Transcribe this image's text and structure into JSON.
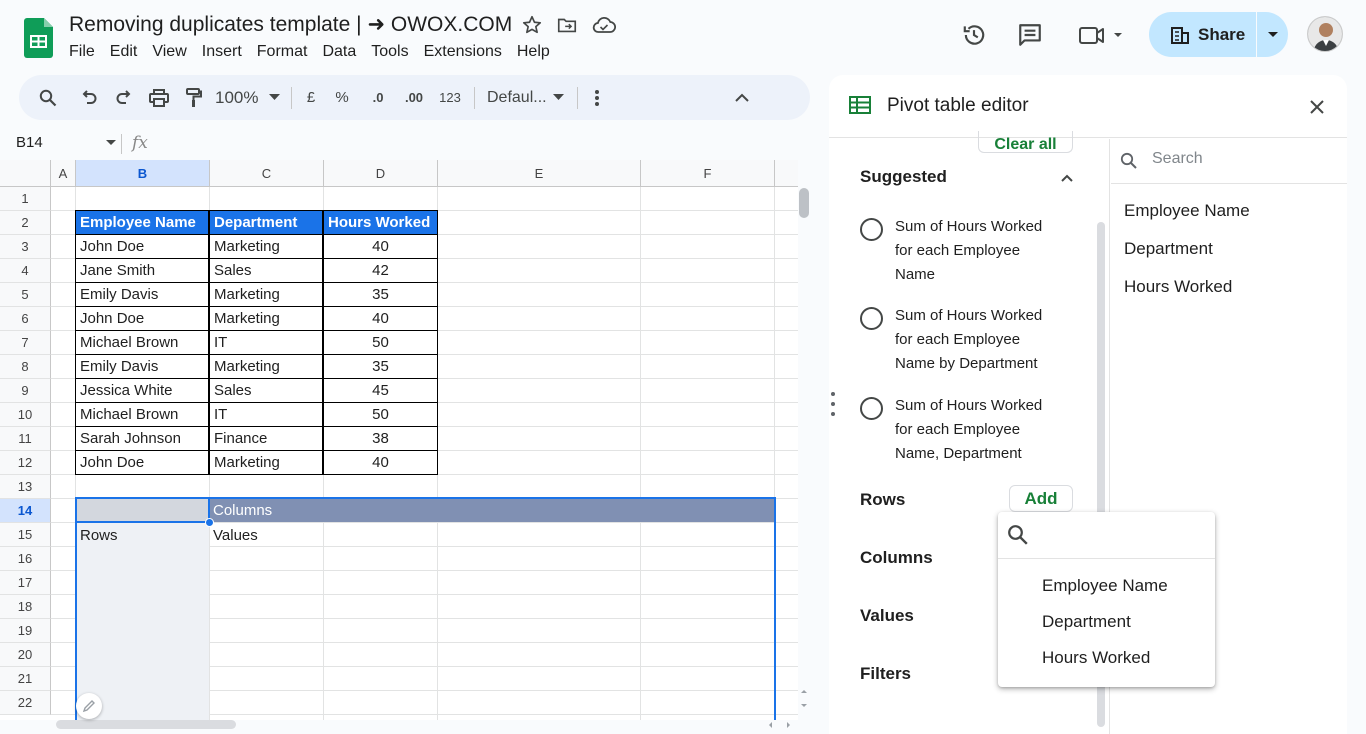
{
  "doc": {
    "title": "Removing duplicates template | ➜ OWOX.COM",
    "menu": [
      "File",
      "Edit",
      "View",
      "Insert",
      "Format",
      "Data",
      "Tools",
      "Extensions",
      "Help"
    ]
  },
  "header": {
    "share_label": "Share"
  },
  "toolbar": {
    "zoom": "100%",
    "currency": "£",
    "percent": "%",
    "dec_decrease": ".0",
    "dec_increase": ".00",
    "number_format": "123",
    "font": "Defaul..."
  },
  "formula_bar": {
    "name_box": "B14",
    "fx": "fx"
  },
  "sheet": {
    "columns": [
      "A",
      "B",
      "C",
      "D",
      "E",
      "F"
    ],
    "rows": [
      "1",
      "2",
      "3",
      "4",
      "5",
      "6",
      "7",
      "8",
      "9",
      "10",
      "11",
      "12",
      "13",
      "14",
      "15",
      "16",
      "17",
      "18",
      "19",
      "20",
      "21",
      "22"
    ],
    "table_header": [
      "Employee Name",
      "Department",
      "Hours Worked"
    ],
    "table_rows": [
      [
        "John Doe",
        "Marketing",
        "40"
      ],
      [
        "Jane Smith",
        "Sales",
        "42"
      ],
      [
        "Emily Davis",
        "Marketing",
        "35"
      ],
      [
        "John Doe",
        "Marketing",
        "40"
      ],
      [
        "Michael Brown",
        "IT",
        "50"
      ],
      [
        "Emily Davis",
        "Marketing",
        "35"
      ],
      [
        "Jessica White",
        "Sales",
        "45"
      ],
      [
        "Michael Brown",
        "IT",
        "50"
      ],
      [
        "Sarah Johnson",
        "Finance",
        "38"
      ],
      [
        "John Doe",
        "Marketing",
        "40"
      ]
    ],
    "pivot": {
      "columns_label": "Columns",
      "rows_label": "Rows",
      "values_label": "Values"
    }
  },
  "pivot_editor": {
    "title": "Pivot table editor",
    "clear_all": "Clear all",
    "suggested_heading": "Suggested",
    "suggestions": [
      "Sum of Hours Worked for each Employee Name",
      "Sum of Hours Worked for each Employee Name by Department",
      "Sum of Hours Worked for each Employee Name, Department"
    ],
    "sections": {
      "rows": "Rows",
      "columns": "Columns",
      "values": "Values",
      "filters": "Filters"
    },
    "add_label": "Add",
    "field_search_placeholder": "Search",
    "fields": [
      "Employee Name",
      "Department",
      "Hours Worked"
    ],
    "add_dropdown": [
      "Employee Name",
      "Department",
      "Hours Worked"
    ]
  },
  "colors": {
    "accent": "#1a73e8",
    "share_bg": "#c2e7ff",
    "green": "#188038",
    "pivot_header": "#8090b3"
  }
}
